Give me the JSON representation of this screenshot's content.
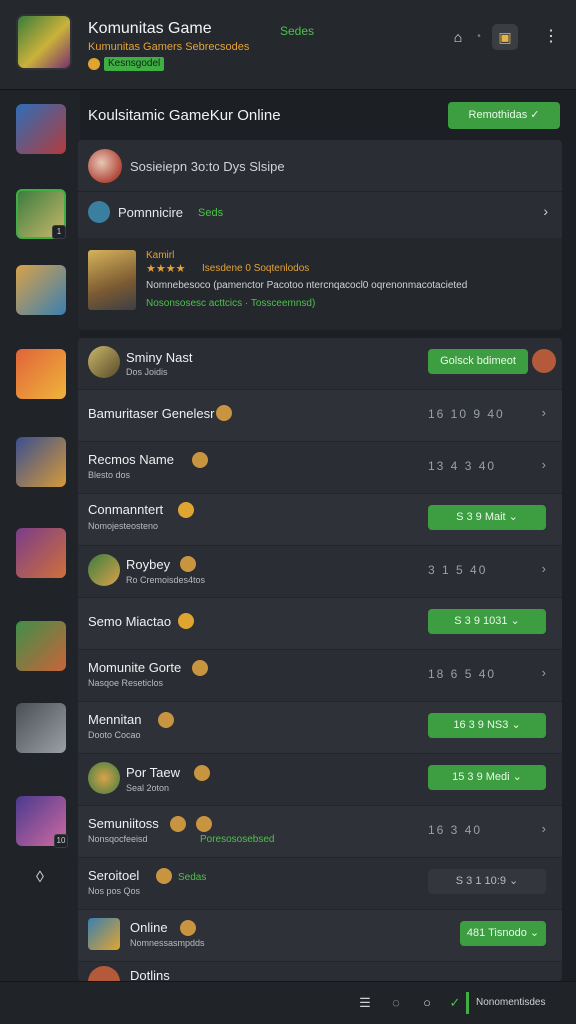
{
  "header": {
    "title": "Komunitas Game",
    "tag": "Sedes",
    "subtitle": "Kumunitas Gamers Sebrecsodes",
    "pill": "Kesnsgodel",
    "icons": [
      "store-icon",
      "dot-separator",
      "bag-icon",
      "more-icon"
    ]
  },
  "rail": {
    "items": [
      {
        "badge": "",
        "color": "#3f7fbf"
      },
      {
        "badge": "1",
        "color": "#3c7d40"
      },
      {
        "badge": "",
        "color": "#d9a24a"
      },
      {
        "badge": "",
        "color": "#e0643a"
      },
      {
        "badge": "",
        "color": "#3a4f8f"
      },
      {
        "badge": "",
        "color": "#7a3d8a"
      },
      {
        "badge": "",
        "color": "#3f8f4a"
      },
      {
        "badge": "",
        "color": "#4a4f55"
      },
      {
        "badge": "10",
        "color": "#4a3a8f"
      }
    ],
    "bottom_icon": "drop-icon"
  },
  "main": {
    "title": "Koulsitamic GameKur Online",
    "top_button": "Remothidas ✓",
    "card": {
      "row1_text": "Sosieiepn 3o:to Dys Slsipe",
      "row2_text": "Pomnnicire",
      "row2_tag": "Seds",
      "row3_name": "Kamirl",
      "row3_stars": "★★★★",
      "row3_rating": "Isesdene 0 Soqtenlodos",
      "row3_desc": "Nomnebesoco (pamenctor Pacotoo ntercnqacocl0 oqrenonmacotacieted",
      "row3_desc2": "Nosonsosesc acttcics · Tossceemnsd)"
    },
    "list": [
      {
        "name": "Sminy Nast",
        "sub": "Dos Joidis",
        "action": "button",
        "action_text": "Golsck bdimeot",
        "tag": ""
      },
      {
        "name": "Bamuritaser Genelesr",
        "sub": "",
        "action": "stats",
        "action_text": "16 10 9 40",
        "tag": ""
      },
      {
        "name": "Recmos Name",
        "sub": "Blesto dos",
        "action": "stats",
        "action_text": "13 4 3 40",
        "tag": ""
      },
      {
        "name": "Conmanntert",
        "sub": "Nomojesteosteno",
        "action": "button",
        "action_text": "S 3 9 Mait ⌄",
        "tag": ""
      },
      {
        "name": "Roybey",
        "sub": "Ro Cremoisdes4tos",
        "action": "stats",
        "action_text": "3 1 5 40",
        "tag": ""
      },
      {
        "name": "Semo Miactao",
        "sub": "",
        "action": "button",
        "action_text": "S 3 9 1031 ⌄",
        "tag": ""
      },
      {
        "name": "Momunite Gorte",
        "sub": "Nasqoe Reseticlos",
        "action": "stats",
        "action_text": "18 6 5 40",
        "tag": ""
      },
      {
        "name": "Mennitan",
        "sub": "Dooto Cocao",
        "action": "button",
        "action_text": "16 3 9 NS3 ⌄",
        "tag": ""
      },
      {
        "name": "Por Taew",
        "sub": "Seal 2oton",
        "action": "button",
        "action_text": "15 3 9 Medi ⌄",
        "tag": ""
      },
      {
        "name": "Semuniitoss",
        "sub": "Nonsqocfeeisd",
        "action": "stats",
        "action_text": "16 3 40",
        "tag": "Poresososebsed"
      },
      {
        "name": "Seroitoel",
        "sub": "Nos pos Qos",
        "action": "dark",
        "action_text": "S 3 1 10:9 ⌄",
        "tag": "Sedas"
      },
      {
        "name": "Online",
        "sub": "Nomnessasmpdds",
        "action": "button-small",
        "action_text": "481 Tisnodo ⌄",
        "tag": ""
      },
      {
        "name": "Dotlins",
        "sub": "",
        "action": "none",
        "action_text": "",
        "tag": ""
      }
    ]
  },
  "bottom": {
    "icons": [
      "list-icon",
      "chat-icon",
      "circle-icon",
      "check-icon"
    ],
    "text": "Nonomentisdes"
  }
}
